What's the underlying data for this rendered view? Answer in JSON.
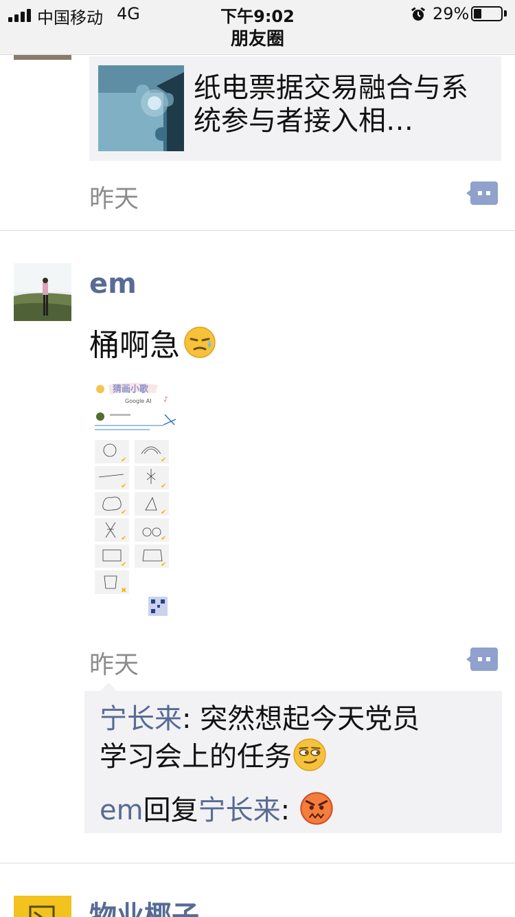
{
  "status_bar": {
    "carrier": "中国移动",
    "network": "4G",
    "time": "下午9:02",
    "battery": "29%",
    "battery_level": 0.29
  },
  "nav": {
    "title": "朋友圈"
  },
  "post1": {
    "link_title": "纸电票据交易融合与系统参与者接入相…",
    "time": "昨天"
  },
  "post2": {
    "author": "em",
    "text": "桶啊急",
    "text_emoji": "sweat-emoji",
    "image_texts": {
      "header": "猜画小歌",
      "sub": "Google AI"
    },
    "time": "昨天",
    "comments": [
      {
        "author": "宁长来",
        "separator": ": ",
        "text": "突然想起今天党员",
        "text2": "学习会上的任务",
        "emoji": "smirk-emoji"
      },
      {
        "author": "em",
        "reply_word": "回复",
        "target": "宁长来",
        "separator": ": ",
        "emoji": "angry-emoji"
      }
    ]
  },
  "post3": {
    "author": "物业椰子"
  },
  "colors": {
    "link_blue": "#576b95",
    "card_bg": "#f2f2f4",
    "time_gray": "#8c8c8c",
    "comment_btn": "#8fa1cc"
  }
}
